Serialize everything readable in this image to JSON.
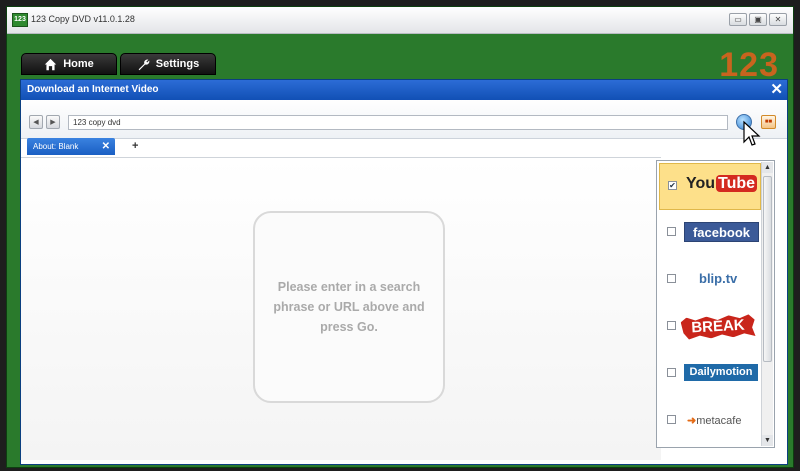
{
  "window": {
    "title": "123 Copy DVD v11.0.1.28",
    "icon_text": "123"
  },
  "window_controls": [
    "▭",
    "▣",
    "✕"
  ],
  "main_tabs": [
    {
      "label": "Home",
      "icon": "home-icon"
    },
    {
      "label": "Settings",
      "icon": "wrench-icon"
    }
  ],
  "brand_logo": "123",
  "dialog": {
    "title": "Download an Internet Video",
    "close": "✕"
  },
  "nav": {
    "back": "◀",
    "forward": "▶",
    "url_value": "123 copy dvd",
    "stop": "■■"
  },
  "browser_tab": {
    "label": "About: Blank",
    "close": "✕",
    "new": "+"
  },
  "message": "Please enter in a search phrase or URL above and press Go.",
  "sites": [
    {
      "name": "YouTube",
      "checked": true
    },
    {
      "name": "facebook",
      "checked": false
    },
    {
      "name": "blip.tv",
      "checked": false
    },
    {
      "name": "BREAK",
      "checked": false
    },
    {
      "name": "Dailymotion",
      "checked": false
    },
    {
      "name": "metacafe",
      "checked": false
    }
  ],
  "colors": {
    "window_green": "#2a7a2c",
    "title_blue": "#1a5fc3",
    "selected_site": "#fde08a"
  }
}
